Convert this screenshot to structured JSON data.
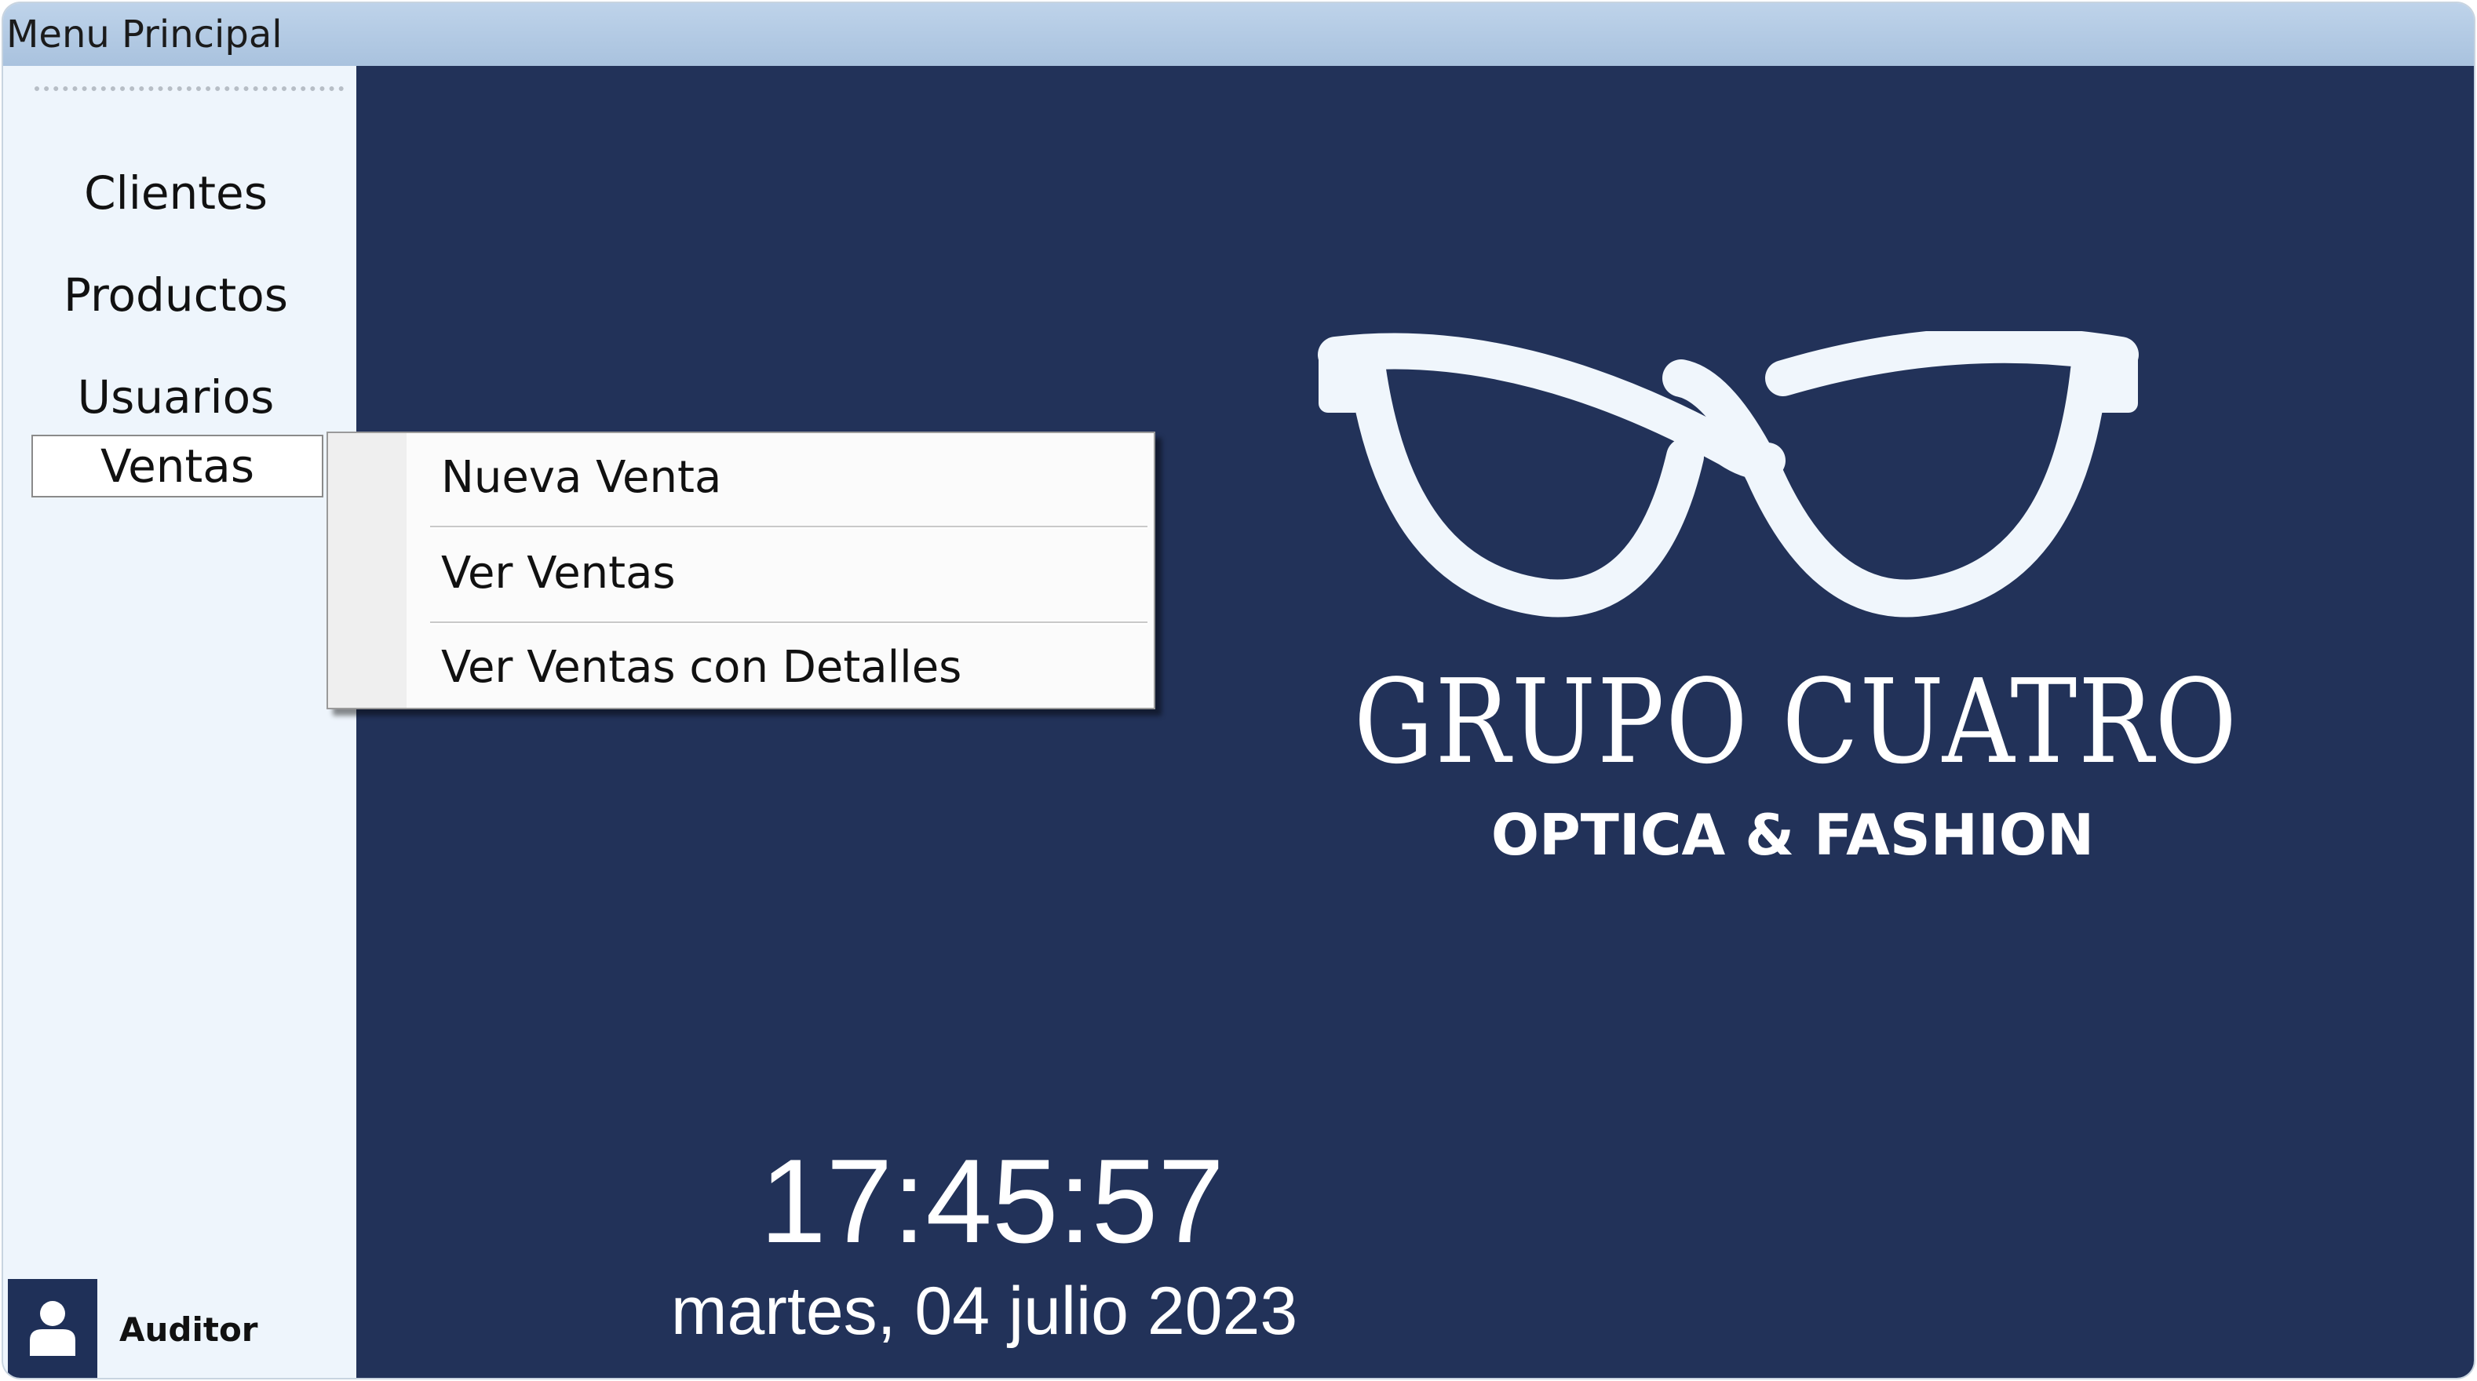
{
  "window": {
    "title": "Menu Principal"
  },
  "sidebar": {
    "items": [
      {
        "label": "Clientes"
      },
      {
        "label": "Productos"
      },
      {
        "label": "Usuarios"
      },
      {
        "label": "Ventas"
      }
    ],
    "user": {
      "name": "Auditor",
      "icon": "user-icon"
    }
  },
  "ventas_menu": {
    "items": [
      {
        "label": "Nueva Venta"
      },
      {
        "label": "Ver Ventas"
      },
      {
        "label": "Ver Ventas con Detalles"
      }
    ]
  },
  "brand": {
    "name": "GRUPO CUATRO",
    "tagline": "OPTICA & FASHION",
    "logo_icon": "glasses-icon"
  },
  "clock": {
    "time": "17:45:57",
    "date": "martes, 04 julio 2023"
  },
  "colors": {
    "main_background": "#223259",
    "sidebar_background": "#eef5fc",
    "titlebar": "#b4cbe4",
    "logo": "#f0f6fc"
  }
}
